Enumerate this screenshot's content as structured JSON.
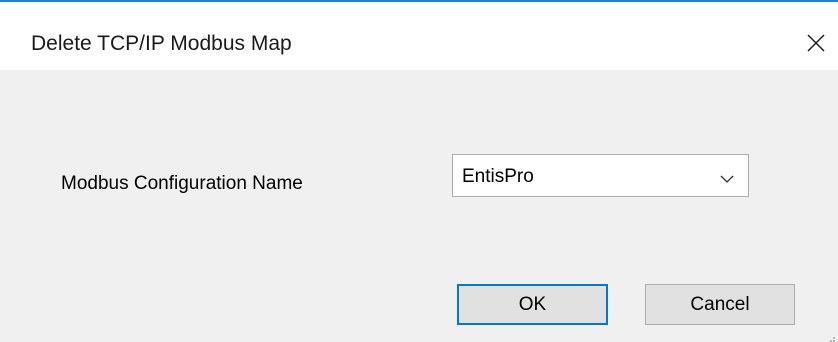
{
  "window": {
    "title": "Delete TCP/IP Modbus Map",
    "close_icon": "close-icon"
  },
  "form": {
    "config_label": "Modbus Configuration Name",
    "config_value": "EntisPro",
    "dropdown_icon": "chevron-down-icon"
  },
  "buttons": {
    "ok_label": "OK",
    "cancel_label": "Cancel"
  },
  "colors": {
    "accent": "#0078d7",
    "title_bar": "#ffffff",
    "client_bg": "#f0f0f0"
  }
}
